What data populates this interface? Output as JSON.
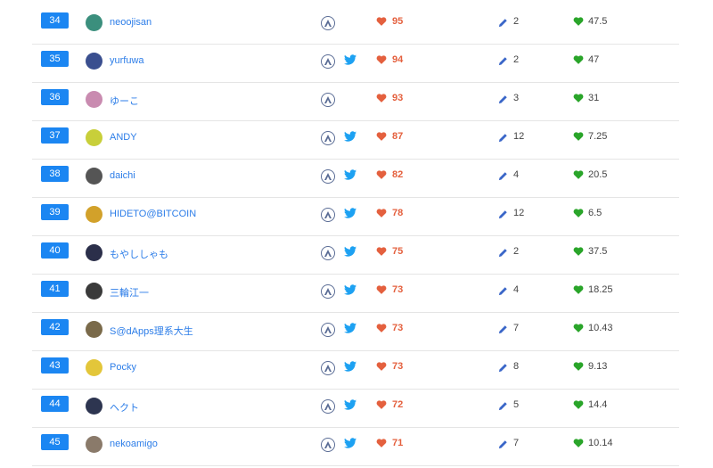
{
  "colors": {
    "rank_badge": "#1b86f2",
    "username": "#2c7de8",
    "likes": "#e4603e",
    "twitter": "#1da1f2",
    "score_heart": "#2aa52a"
  },
  "rows": [
    {
      "rank": "34",
      "username": "neoojisan",
      "twitter": false,
      "likes": "95",
      "articles": "2",
      "score": "47.5",
      "avatar_color": "#3b8f7d"
    },
    {
      "rank": "35",
      "username": "yurfuwa",
      "twitter": true,
      "likes": "94",
      "articles": "2",
      "score": "47",
      "avatar_color": "#3a4f8f"
    },
    {
      "rank": "36",
      "username": "ゆーこ",
      "twitter": false,
      "likes": "93",
      "articles": "3",
      "score": "31",
      "avatar_color": "#c98bb0"
    },
    {
      "rank": "37",
      "username": "ANDY",
      "twitter": true,
      "likes": "87",
      "articles": "12",
      "score": "7.25",
      "avatar_color": "#c8cf3a"
    },
    {
      "rank": "38",
      "username": "daichi",
      "twitter": true,
      "likes": "82",
      "articles": "4",
      "score": "20.5",
      "avatar_color": "#555555"
    },
    {
      "rank": "39",
      "username": "HIDETO@BITCOIN",
      "twitter": true,
      "likes": "78",
      "articles": "12",
      "score": "6.5",
      "avatar_color": "#d2a12a"
    },
    {
      "rank": "40",
      "username": "もやししゃも",
      "twitter": true,
      "likes": "75",
      "articles": "2",
      "score": "37.5",
      "avatar_color": "#2b2f4a"
    },
    {
      "rank": "41",
      "username": "三輪江一",
      "twitter": true,
      "likes": "73",
      "articles": "4",
      "score": "18.25",
      "avatar_color": "#3a3a3a"
    },
    {
      "rank": "42",
      "username": "S@dApps理系大生",
      "twitter": true,
      "likes": "73",
      "articles": "7",
      "score": "10.43",
      "avatar_color": "#7a6a4a"
    },
    {
      "rank": "43",
      "username": "Pocky",
      "twitter": true,
      "likes": "73",
      "articles": "8",
      "score": "9.13",
      "avatar_color": "#e3c63a"
    },
    {
      "rank": "44",
      "username": "ヘクト",
      "twitter": true,
      "likes": "72",
      "articles": "5",
      "score": "14.4",
      "avatar_color": "#2d3550"
    },
    {
      "rank": "45",
      "username": "nekoamigo",
      "twitter": true,
      "likes": "71",
      "articles": "7",
      "score": "10.14",
      "avatar_color": "#8a7a6a"
    }
  ]
}
